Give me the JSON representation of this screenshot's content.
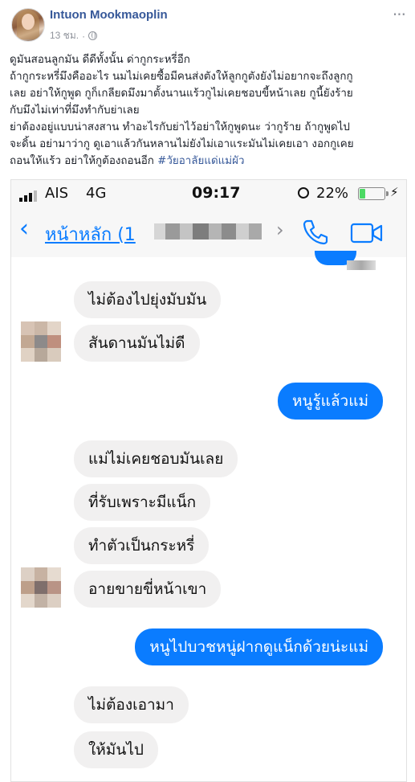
{
  "post": {
    "author": "Intuon Mookmaoplin",
    "time": "13 ชม.",
    "separator": "·",
    "more": "···",
    "lines": [
      "ดูมันสอนลูกมัน ดีดีทั้งนั้น ด่ากูกระหรี่อีก",
      "ถ้ากูกระหรี่มึงคืออะไร นมไม่เคยซื้อมีคนส่งตังให้ลูกกูตังยังไม่อยากจะถึงลูกกู",
      "เลย อย่าให้กูพูด กูก็เกลียดมึงมาตั้งนานแร้วกูไม่เคยชอบขี้หน้าเลย กูนี้ยังร้าย",
      "กับมึงไม่เท่าที่มึงทำกับย่าเลย",
      "ย่าต้องอยู่แบบน่าสงสาน ทำอะไรกับย่าไว้อย่าให้กูพูดนะ ว่ากูร้าย ถ้ากูพูดไป",
      "จะดิ้น อย่ามาว่ากู ดูเอาแล้วกันหลานไม่ยังไม่เอาแระมันไม่เคยเอา งอกกูเคย"
    ],
    "last_line": "ถอนให้แร้ว อย่าให้กูต้องถอนอีก ",
    "hashtag": "#วัยอาลัยแด่แม่ผัว"
  },
  "screenshot": {
    "status": {
      "carrier": "AIS",
      "network": "4G",
      "time": "09:17",
      "battery": "22%",
      "battery_level": 0.22,
      "bolt": "⚡"
    },
    "nav": {
      "back_icon": "‹",
      "back_label": "หน้าหลัก (1",
      "chevron": "›",
      "call_icon": "phone-icon",
      "video_icon": "video-camera-icon",
      "accent": "#0a7cff"
    },
    "messages": [
      {
        "from": "other",
        "text": "ไม่ต้องไปยุ่งมับมัน"
      },
      {
        "from": "other",
        "text": "สันดานมันไม่ดี"
      },
      {
        "from": "me",
        "text": "หนูรู้แล้วแม่"
      },
      {
        "from": "other",
        "text": "แม่ไม่เคยชอบมันเลย"
      },
      {
        "from": "other",
        "text": "ที่รับเพราะมีแน็ก"
      },
      {
        "from": "other",
        "text": "ทำตัวเป็นกระหรี่"
      },
      {
        "from": "other",
        "text": "อายขายขี่หน้าเขา"
      },
      {
        "from": "me",
        "text": "หนูไปบวชหนู่ฝากดูแน็กด้วยน่ะแม่"
      },
      {
        "from": "other",
        "text": "ไม่ต้องเอามา"
      },
      {
        "from": "other",
        "text": "ให้มันไป"
      }
    ]
  }
}
